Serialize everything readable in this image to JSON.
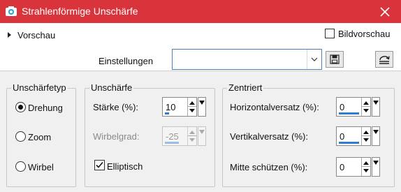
{
  "window": {
    "title": "Strahlenförmige Unschärfe",
    "close_icon": "close-icon",
    "app_icon": "camera-icon",
    "title_color": "#d9343c"
  },
  "preview": {
    "expander_label": "Vorschau",
    "bild_label": "Bildvorschau",
    "bild_checked": false
  },
  "settings": {
    "label": "Einstellungen",
    "value": "",
    "save_icon": "save-icon",
    "reset_icon": "reset-icon"
  },
  "blur_type": {
    "legend": "Unschärfetyp",
    "options": [
      {
        "label": "Drehung",
        "selected": true
      },
      {
        "label": "Zoom",
        "selected": false
      },
      {
        "label": "Wirbel",
        "selected": false
      }
    ]
  },
  "blur": {
    "legend": "Unschärfe",
    "strength_label": "Stärke (%):",
    "strength_value": "10",
    "strength_level": 0.1,
    "swirl_label": "Wirbelgrad:",
    "swirl_value": "-25",
    "swirl_enabled": false,
    "elliptical_label": "Elliptisch",
    "elliptical_checked": true
  },
  "centered": {
    "legend": "Zentriert",
    "horizontal_label": "Horizontalversatz (%):",
    "horizontal_value": "0",
    "vertical_label": "Vertikalversatz (%):",
    "vertical_value": "0",
    "protect_label": "Mitte schützen (%):",
    "protect_value": "0"
  },
  "colors": {
    "accent": "#2a7ed3",
    "panel_bg": "#f0f0f0",
    "focus_border": "#4a7fc1"
  }
}
